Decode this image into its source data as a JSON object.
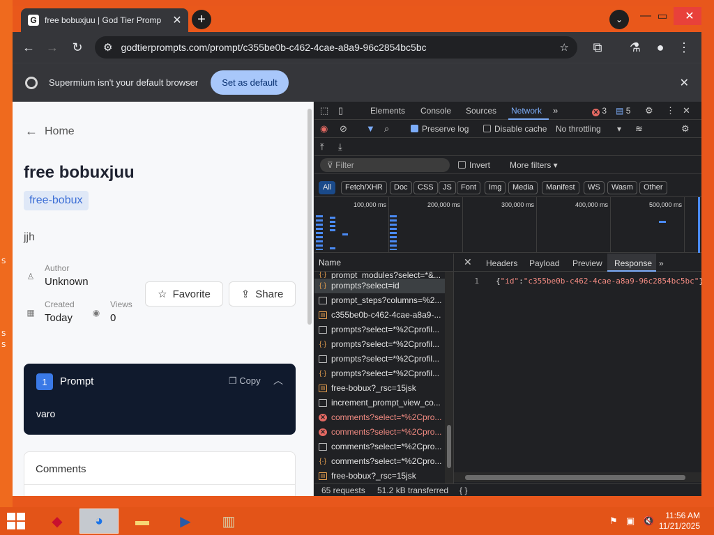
{
  "desktop": {
    "edge_text": [
      "S",
      "S",
      "S"
    ]
  },
  "browser": {
    "tab_title": "free bobuxjuu | God Tier Promp",
    "tab_favicon": "G",
    "url": "godtierprompts.com/prompt/c355be0b-c462-4cae-a8a9-96c2854bc5bc",
    "infobar": {
      "text": "Supermium isn't your default browser",
      "button": "Set as default"
    }
  },
  "page": {
    "back_label": "Home",
    "title": "free bobuxjuu",
    "tag": "free-bobux",
    "description": "jjh",
    "author_label": "Author",
    "author_value": "Unknown",
    "created_label": "Created",
    "created_value": "Today",
    "views_label": "Views",
    "views_value": "0",
    "favorite_label": "Favorite",
    "share_label": "Share",
    "prompt_card": {
      "number": "1",
      "label": "Prompt",
      "copy": "Copy",
      "text": "varo"
    },
    "comments_title": "Comments"
  },
  "devtools": {
    "tabs": [
      "Elements",
      "Console",
      "Sources",
      "Network"
    ],
    "active_tab": "Network",
    "errors": "3",
    "messages": "5",
    "preserve_log": "Preserve log",
    "disable_cache": "Disable cache",
    "throttling": "No throttling",
    "filter_placeholder": "Filter",
    "invert": "Invert",
    "more_filters": "More filters",
    "type_filters": [
      "All",
      "Fetch/XHR",
      "Doc",
      "CSS",
      "JS",
      "Font",
      "Img",
      "Media",
      "Manifest",
      "WS",
      "Wasm",
      "Other"
    ],
    "timeline_labels": [
      "100,000 ms",
      "200,000 ms",
      "300,000 ms",
      "400,000 ms",
      "500,000 ms"
    ],
    "name_header": "Name",
    "requests": [
      {
        "name": "prompt_modules?select=*&...",
        "type": "fetch",
        "state": "partial"
      },
      {
        "name": "prompts?select=id",
        "type": "fetch",
        "state": "selected"
      },
      {
        "name": "prompt_steps?columns=%2...",
        "type": "doc",
        "state": "normal"
      },
      {
        "name": "c355be0b-c462-4cae-a8a9-...",
        "type": "script",
        "state": "normal"
      },
      {
        "name": "prompts?select=*%2Cprofil...",
        "type": "doc",
        "state": "normal"
      },
      {
        "name": "prompts?select=*%2Cprofil...",
        "type": "fetch",
        "state": "normal"
      },
      {
        "name": "prompts?select=*%2Cprofil...",
        "type": "doc",
        "state": "normal"
      },
      {
        "name": "prompts?select=*%2Cprofil...",
        "type": "fetch",
        "state": "normal"
      },
      {
        "name": "free-bobux?_rsc=15jsk",
        "type": "script",
        "state": "normal"
      },
      {
        "name": "increment_prompt_view_co...",
        "type": "doc",
        "state": "normal"
      },
      {
        "name": "comments?select=*%2Cpro...",
        "type": "err",
        "state": "error"
      },
      {
        "name": "comments?select=*%2Cpro...",
        "type": "err",
        "state": "error"
      },
      {
        "name": "comments?select=*%2Cpro...",
        "type": "doc",
        "state": "normal"
      },
      {
        "name": "comments?select=*%2Cpro...",
        "type": "fetch",
        "state": "normal"
      },
      {
        "name": "free-bobux?_rsc=15jsk",
        "type": "script",
        "state": "normal"
      }
    ],
    "detail_tabs": [
      "Headers",
      "Payload",
      "Preview",
      "Response"
    ],
    "active_detail_tab": "Response",
    "response_line_number": "1",
    "response_key": "\"id\"",
    "response_value": "\"c355be0b-c462-4cae-a8a9-96c2854bc5bc\"",
    "requests_count": "65 requests",
    "transferred": "51.2 kB transferred"
  },
  "taskbar": {
    "time": "11:56 AM",
    "date": "11/21/2025"
  },
  "colors": {
    "taskbar": "#e35418",
    "accent": "#7cacf8",
    "error": "#e46962"
  }
}
